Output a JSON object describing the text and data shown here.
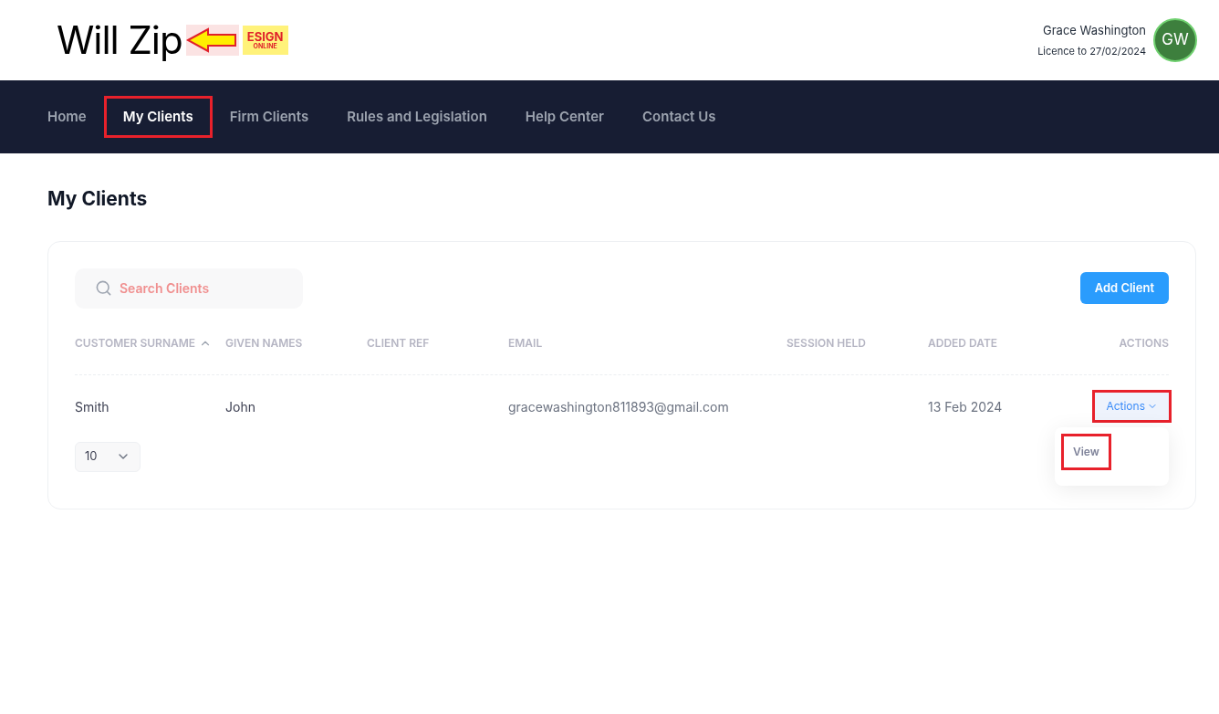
{
  "logo": {
    "wordmark": "Will Zip",
    "badge_line_1": "ESIGN",
    "badge_line_2": "ONLINE"
  },
  "user": {
    "name": "Grace Washington",
    "licence": "Licence to 27/02/2024",
    "initials": "GW"
  },
  "nav": [
    {
      "label": "Home",
      "selected": false,
      "highlighted": false
    },
    {
      "label": "My Clients",
      "selected": true,
      "highlighted": true
    },
    {
      "label": "Firm Clients",
      "selected": false,
      "highlighted": false
    },
    {
      "label": "Rules and Legislation",
      "selected": false,
      "highlighted": false
    },
    {
      "label": "Help Center",
      "selected": false,
      "highlighted": false
    },
    {
      "label": "Contact Us",
      "selected": false,
      "highlighted": false
    }
  ],
  "page_title": "My Clients",
  "search": {
    "placeholder": "Search Clients"
  },
  "add_button": "Add Client",
  "table": {
    "columns": [
      {
        "label": "CUSTOMER SURNAME",
        "sorted": true
      },
      {
        "label": "GIVEN NAMES",
        "sorted": false
      },
      {
        "label": "CLIENT REF",
        "sorted": false
      },
      {
        "label": "EMAIL",
        "sorted": false
      },
      {
        "label": "SESSION HELD",
        "sorted": false
      },
      {
        "label": "ADDED DATE",
        "sorted": false
      },
      {
        "label": "ACTIONS",
        "sorted": false
      }
    ],
    "rows": [
      {
        "cells": [
          "Smith",
          "John",
          "",
          "gracewashington811893@gmail.com",
          "",
          "13 Feb 2024"
        ],
        "actions": {
          "label": "Actions",
          "highlighted": true,
          "expanded": true,
          "menu": [
            {
              "label": "View",
              "highlighted": true
            }
          ]
        }
      }
    ]
  },
  "page_size": "10"
}
